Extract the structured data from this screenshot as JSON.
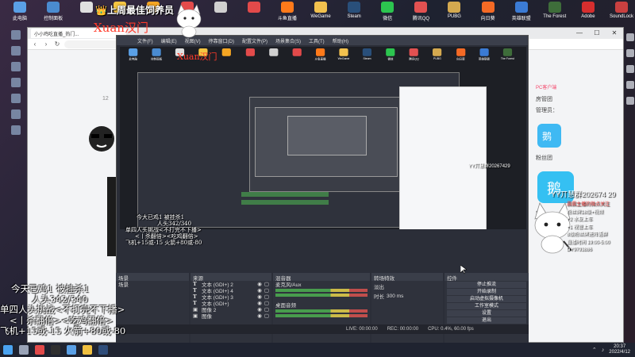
{
  "desktop": {
    "icons": [
      {
        "label": "此电脑",
        "color": "#5aa0e6"
      },
      {
        "label": "控制面板",
        "color": "#4a8bd0"
      },
      {
        "label": "",
        "color": "#e0e0e0"
      },
      {
        "label": "",
        "color": "#f5c542"
      },
      {
        "label": "",
        "color": "#f5a623"
      },
      {
        "label": "",
        "color": "#e34b4b"
      },
      {
        "label": "",
        "color": "#d0d0d0"
      },
      {
        "label": "",
        "color": "#e24a4a"
      },
      {
        "label": "斗鱼直播",
        "color": "#ff7a1a"
      },
      {
        "label": "WeGame",
        "color": "#f2c14e"
      },
      {
        "label": "Steam",
        "color": "#294f7a"
      },
      {
        "label": "微信",
        "color": "#2cc54f"
      },
      {
        "label": "腾讯QQ",
        "color": "#e25151"
      },
      {
        "label": "PUBG",
        "color": "#d4a94f"
      },
      {
        "label": "向日葵",
        "color": "#f46a25"
      },
      {
        "label": "英雄联盟",
        "color": "#3b7bd4"
      },
      {
        "label": "The Forest",
        "color": "#3e6d3a"
      },
      {
        "label": "Adobe",
        "color": "#d62e2e"
      },
      {
        "label": "SoundLock",
        "color": "#c94040"
      }
    ]
  },
  "overlay": {
    "champion": "👑上周最佳饲养员",
    "username": "Xuan汉门",
    "username_nested": "Xuan汉门",
    "stats": {
      "line0": "今天已鸡1 被挂杀1",
      "line1": "人头342/340",
      "line2": "单四人头挑战<不打完不下播>",
      "line3": "<丨杀翻倍><吃鸡翻倍>",
      "line4": "飞机+15或-15 火箭+80或-80"
    },
    "stats_nested": {
      "line0": "今大已鸡1 被挂杀1",
      "line1": "人头342/340",
      "line2": "单四人头挑战<不打完不下播>",
      "line3": "<丨杀翻倍><吃鸡翻倍>",
      "line4": "飞机+15或-15 火箭+80或-80"
    },
    "yy": "YY丌慧群202674 29",
    "yy_nested": "YY丌慧群20267429"
  },
  "browser": {
    "tab_title": "小小鸡吃直播_热门...",
    "url": "",
    "window_buttons": [
      "—",
      "☐",
      "✕"
    ]
  },
  "stream": {
    "left_number": "12",
    "chat": {
      "tag": "PC客户端",
      "labels": [
        "房管团",
        "管理员：",
        "粉丝团",
        "新人"
      ],
      "announcement": {
        "line0": "震震主播的微点关注",
        "line1": "粉丝牌18级+视频",
        "line2": "+2 水友上车",
        "line3": "+1 视管上车",
        "line4": "8级粉丝牌进阵语群",
        "line5": "直播时间 19:00-5:00",
        "line6": "DY9793886"
      }
    }
  },
  "obs": {
    "menu": [
      "文件(F)",
      "编辑(E)",
      "视图(V)",
      "停靠窗口(D)",
      "配置文件(P)",
      "场景集合(S)",
      "工具(T)",
      "帮助(H)"
    ],
    "panels": {
      "scenes": {
        "title": "场景",
        "items": [
          "场景"
        ]
      },
      "sources": {
        "title": "来源",
        "items": [
          {
            "icon": "T",
            "name": "文本 (GDI+) 2"
          },
          {
            "icon": "T",
            "name": "文本 (GDI+) 4"
          },
          {
            "icon": "T",
            "name": "文本 (GDI+) 3"
          },
          {
            "icon": "T",
            "name": "文本 (GDI+)"
          },
          {
            "icon": "▣",
            "name": "图像 2"
          },
          {
            "icon": "▣",
            "name": "图像"
          }
        ]
      },
      "mixer": {
        "title": "混音器",
        "tracks": [
          "麦克风/Aux",
          "桌面音频"
        ]
      },
      "transitions": {
        "title": "转场特效",
        "type": "淡出",
        "duration_label": "时长",
        "duration": "300 ms"
      },
      "controls": {
        "title": "控件",
        "buttons": [
          "停止推流",
          "开始录制",
          "启动虚拟摄像机",
          "工作室模式",
          "设置",
          "退出"
        ]
      }
    },
    "status": {
      "live": "LIVE: 00:00:00",
      "rec": "REC: 00:00:00",
      "cpu": "CPU: 0.4%, 60.00 fps"
    }
  },
  "taskbar": {
    "icons": [
      {
        "name": "start",
        "color": "#4aa3f0"
      },
      {
        "name": "search",
        "color": "#9aa4b8"
      },
      {
        "name": "app-1",
        "color": "#e24a4a"
      },
      {
        "name": "app-2",
        "color": "#2f2f2f"
      },
      {
        "name": "app-3",
        "color": "#5aa0e6"
      },
      {
        "name": "app-4",
        "color": "#f0c040"
      },
      {
        "name": "app-5",
        "color": "#2f4d7a"
      }
    ],
    "time": "20:37",
    "date": "2022/4/12"
  },
  "colors": {
    "accent": "#ff3a2a",
    "obs_bg": "#2b2e38",
    "chat_pink": "#f4476b"
  }
}
